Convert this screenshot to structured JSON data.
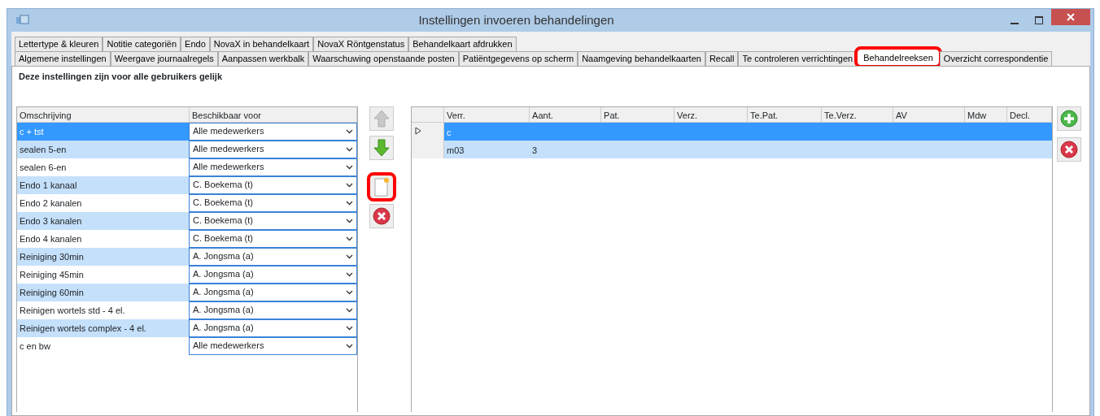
{
  "window": {
    "title": "Instellingen invoeren behandelingen"
  },
  "tab_rows": [
    [
      {
        "label": "Lettertype & kleuren",
        "selected": false,
        "highlighted": false
      },
      {
        "label": "Notitie categoriën",
        "selected": false,
        "highlighted": false
      },
      {
        "label": "Endo",
        "selected": false,
        "highlighted": false
      },
      {
        "label": "NovaX in behandelkaart",
        "selected": false,
        "highlighted": false
      },
      {
        "label": "NovaX Röntgenstatus",
        "selected": false,
        "highlighted": false
      },
      {
        "label": "Behandelkaart afdrukken",
        "selected": false,
        "highlighted": false
      }
    ],
    [
      {
        "label": "Algemene instellingen",
        "selected": false,
        "highlighted": false
      },
      {
        "label": "Weergave journaalregels",
        "selected": false,
        "highlighted": false
      },
      {
        "label": "Aanpassen werkbalk",
        "selected": false,
        "highlighted": false
      },
      {
        "label": "Waarschuwing openstaande posten",
        "selected": false,
        "highlighted": false
      },
      {
        "label": "Patiëntgegevens op scherm",
        "selected": false,
        "highlighted": false
      },
      {
        "label": "Naamgeving behandelkaarten",
        "selected": false,
        "highlighted": false
      },
      {
        "label": "Recall",
        "selected": false,
        "highlighted": false
      },
      {
        "label": "Te controleren verrichtingen",
        "selected": false,
        "highlighted": false
      },
      {
        "label": "Behandelreeksen",
        "selected": true,
        "highlighted": true
      },
      {
        "label": "Overzicht correspondentie",
        "selected": false,
        "highlighted": false
      }
    ]
  ],
  "notice": "Deze instellingen zijn voor alle gebruikers gelijk",
  "series_table": {
    "columns": [
      "Omschrijving",
      "Beschikbaar voor"
    ],
    "rows": [
      {
        "name": "c + tst",
        "available_for": "Alle medewerkers",
        "selected": true
      },
      {
        "name": "sealen 5-en",
        "available_for": "Alle medewerkers",
        "selected": false
      },
      {
        "name": "sealen 6-en",
        "available_for": "Alle medewerkers",
        "selected": false
      },
      {
        "name": "Endo 1 kanaal",
        "available_for": "C. Boekema (t)",
        "selected": false
      },
      {
        "name": "Endo 2 kanalen",
        "available_for": "C. Boekema (t)",
        "selected": false
      },
      {
        "name": "Endo 3 kanalen",
        "available_for": "C. Boekema (t)",
        "selected": false
      },
      {
        "name": "Endo 4 kanalen",
        "available_for": "C. Boekema (t)",
        "selected": false
      },
      {
        "name": "Reiniging 30min",
        "available_for": "A. Jongsma (a)",
        "selected": false
      },
      {
        "name": "Reiniging 45min",
        "available_for": "A. Jongsma (a)",
        "selected": false
      },
      {
        "name": "Reiniging 60min",
        "available_for": "A. Jongsma (a)",
        "selected": false
      },
      {
        "name": "Reinigen wortels std - 4 el.",
        "available_for": "A. Jongsma (a)",
        "selected": false
      },
      {
        "name": "Reinigen wortels complex - 4 el.",
        "available_for": "A. Jongsma (a)",
        "selected": false
      },
      {
        "name": "c en bw",
        "available_for": "Alle medewerkers",
        "selected": false
      }
    ]
  },
  "middle_buttons": [
    {
      "kind": "up",
      "disabled": true,
      "highlighted": false
    },
    {
      "kind": "down",
      "disabled": false,
      "highlighted": false
    },
    {
      "kind": "new",
      "disabled": false,
      "highlighted": true
    },
    {
      "kind": "delete",
      "disabled": false,
      "highlighted": false
    }
  ],
  "procedures_table": {
    "columns": [
      "Verr.",
      "Aant.",
      "Pat.",
      "Verz.",
      "Te.Pat.",
      "Te.Verz.",
      "AV",
      "Mdw",
      "Decl."
    ],
    "rows": [
      {
        "cells": [
          "c",
          "",
          "",
          "",
          "",
          "",
          "",
          "",
          ""
        ],
        "selected": true,
        "current": true
      },
      {
        "cells": [
          "m03",
          "3",
          "",
          "",
          "",
          "",
          "",
          "",
          ""
        ],
        "selected": false,
        "current": false
      }
    ]
  },
  "right_buttons": [
    {
      "kind": "add"
    },
    {
      "kind": "delete"
    }
  ]
}
